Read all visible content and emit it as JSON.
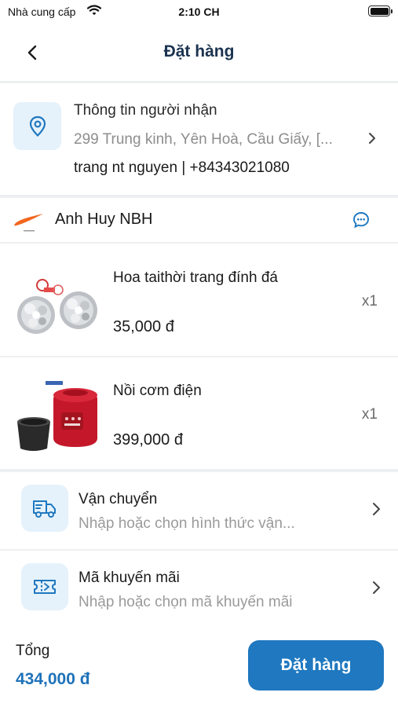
{
  "status_bar": {
    "carrier": "Nhà cung cấp",
    "time": "2:10 CH"
  },
  "nav": {
    "title": "Đặt hàng",
    "back_icon": "chevron-left-icon"
  },
  "address": {
    "title": "Thông tin người nhận",
    "line": "299 Trung kinh, Yên Hoà, Cầu Giấy, [...",
    "contact": "trang nt nguyen | +84343021080",
    "icon": "location-pin-icon"
  },
  "shop": {
    "name": "Anh Huy NBH",
    "logo": "swoosh-logo",
    "chat_icon": "chat-bubble-icon"
  },
  "products": [
    {
      "name": "Hoa taithời trang đính đá",
      "price": "35,000 đ",
      "qty": "x1",
      "thumb": "earrings-image"
    },
    {
      "name": "Nồi cơm điện",
      "price": "399,000 đ",
      "qty": "x1",
      "thumb": "rice-cooker-image"
    }
  ],
  "shipping": {
    "title": "Vận chuyển",
    "hint": "Nhập hoặc chọn hình thức vận...",
    "icon": "truck-icon"
  },
  "promo": {
    "title": "Mã khuyến mãi",
    "hint": "Nhập hoặc chọn mã khuyến mãi",
    "icon": "ticket-icon"
  },
  "footer": {
    "total_label": "Tổng",
    "total_value": "434,000 đ",
    "order_button": "Đặt hàng"
  },
  "colors": {
    "accent": "#1f78c0",
    "icon_bg": "#e5f2fb",
    "title": "#1b3350",
    "swoosh": "#f2671f"
  }
}
